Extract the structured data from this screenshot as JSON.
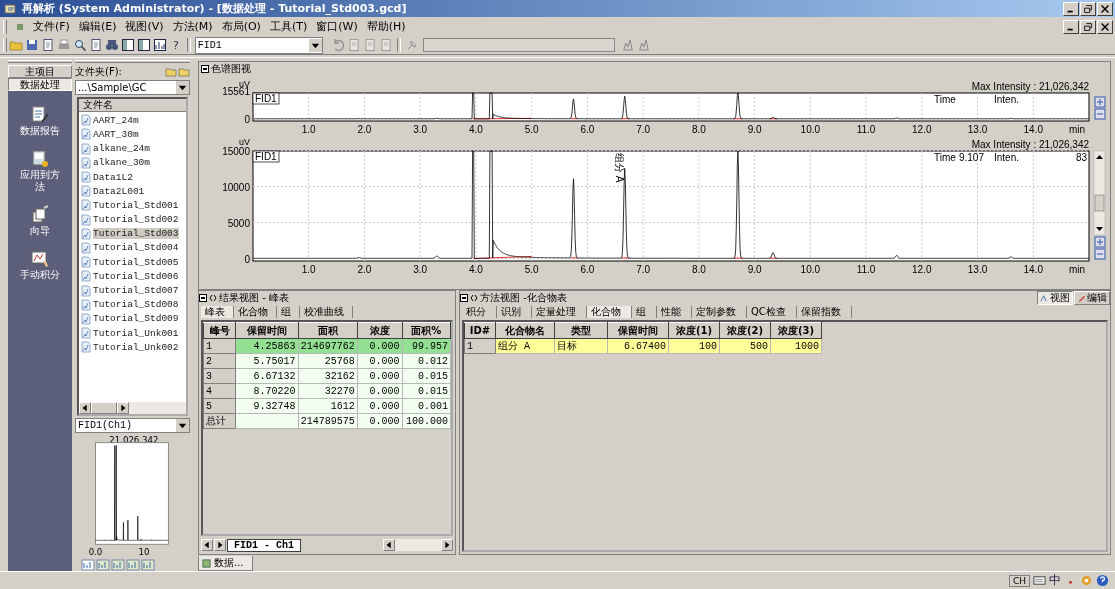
{
  "window": {
    "title": "再解析 (System Administrator) - [数据处理 - Tutorial_Std003.gcd]"
  },
  "menu": [
    "文件(F)",
    "编辑(E)",
    "视图(V)",
    "方法(M)",
    "布局(O)",
    "工具(T)",
    "窗口(W)",
    "帮助(H)"
  ],
  "toolbar": {
    "help": "?",
    "channel": "FID1"
  },
  "nav": {
    "tabs": [
      {
        "label": "主项目",
        "selected": false
      },
      {
        "label": "数据处理",
        "selected": true
      }
    ],
    "items": [
      "数据报告",
      "应用到方法",
      "向导",
      "手动积分"
    ]
  },
  "files": {
    "folder_label": "文件夹(F):",
    "folder": "...\\Sample\\GC",
    "column": "文件名",
    "items": [
      {
        "name": "AART_24m",
        "selected": false
      },
      {
        "name": "AART_30m",
        "selected": false
      },
      {
        "name": "alkane_24m",
        "selected": false
      },
      {
        "name": "alkane_30m",
        "selected": false
      },
      {
        "name": "Data1L2",
        "selected": false
      },
      {
        "name": "Data2L001",
        "selected": false
      },
      {
        "name": "Tutorial_Std001",
        "selected": false
      },
      {
        "name": "Tutorial_Std002",
        "selected": false
      },
      {
        "name": "Tutorial_Std003",
        "selected": true
      },
      {
        "name": "Tutorial_Std004",
        "selected": false
      },
      {
        "name": "Tutorial_Std005",
        "selected": false
      },
      {
        "name": "Tutorial_Std006",
        "selected": false
      },
      {
        "name": "Tutorial_Std007",
        "selected": false
      },
      {
        "name": "Tutorial_Std008",
        "selected": false
      },
      {
        "name": "Tutorial_Std009",
        "selected": false
      },
      {
        "name": "Tutorial_Unk001",
        "selected": false
      },
      {
        "name": "Tutorial_Unk002",
        "selected": false
      }
    ],
    "channel": "FID1(Ch1)",
    "preview_max": "21,026,342",
    "preview_xticks": [
      "0.0",
      "10"
    ]
  },
  "chromatogram_view": {
    "title": "色谱图视",
    "panels": [
      {
        "unit": "uV",
        "channel": "FID1",
        "max_intensity": "Max Intensity : 21,026,342",
        "time_label": "Time",
        "inten_label": "Inten.",
        "yticks": [
          "15561",
          "0"
        ],
        "xticks": [
          "1.0",
          "2.0",
          "3.0",
          "4.0",
          "5.0",
          "6.0",
          "7.0",
          "8.0",
          "9.0",
          "10.0",
          "11.0",
          "12.0",
          "13.0",
          "14.0"
        ],
        "xunit": "min"
      },
      {
        "unit": "uV",
        "channel": "FID1",
        "max_intensity": "Max Intensity : 21,026,342",
        "time_label": "Time",
        "time_value": "9.107",
        "inten_label": "Inten.",
        "inten_value": "83",
        "yticks": [
          "15000",
          "10000",
          "5000",
          "0"
        ],
        "xticks": [
          "1.0",
          "2.0",
          "3.0",
          "4.0",
          "5.0",
          "6.0",
          "7.0",
          "8.0",
          "9.0",
          "10.0",
          "11.0",
          "12.0",
          "13.0",
          "14.0"
        ],
        "xunit": "min",
        "peak_label": "组分 A"
      }
    ]
  },
  "results": {
    "title": "结果视图 -  峰表",
    "tabs": [
      {
        "label": "峰表",
        "selected": true
      },
      {
        "label": "化合物",
        "selected": false
      },
      {
        "label": "组",
        "selected": false
      },
      {
        "label": "校准曲线",
        "selected": false
      }
    ],
    "columns": [
      "峰号",
      "保留时间",
      "面积",
      "浓度",
      "面积%"
    ],
    "rows": [
      {
        "cells": [
          "1",
          "4.25863",
          "214697762",
          "0.000",
          "99.957"
        ],
        "selected": true
      },
      {
        "cells": [
          "2",
          "5.75017",
          "25768",
          "0.000",
          "0.012"
        ],
        "selected": false
      },
      {
        "cells": [
          "3",
          "6.67132",
          "32162",
          "0.000",
          "0.015"
        ],
        "selected": false
      },
      {
        "cells": [
          "4",
          "8.70220",
          "32270",
          "0.000",
          "0.015"
        ],
        "selected": false
      },
      {
        "cells": [
          "5",
          "9.32748",
          "1612",
          "0.000",
          "0.001"
        ],
        "selected": false
      }
    ],
    "total": {
      "label": "总计",
      "area": "214789575",
      "conc": "0.000",
      "percent": "100.000"
    },
    "sheet_tab": "FID1 - Ch1"
  },
  "method": {
    "title": "方法视图 -化合物表",
    "buttons": [
      "视图",
      "编辑"
    ],
    "tabs": [
      {
        "label": "积分",
        "selected": false
      },
      {
        "label": "识别",
        "selected": false
      },
      {
        "label": "定量处理",
        "selected": false
      },
      {
        "label": "化合物",
        "selected": true
      },
      {
        "label": "组",
        "selected": false
      },
      {
        "label": "性能",
        "selected": false
      },
      {
        "label": "定制参数",
        "selected": false
      },
      {
        "label": "QC检查",
        "selected": false
      },
      {
        "label": "保留指数",
        "selected": false
      }
    ],
    "columns": [
      "ID#",
      "化合物名",
      "类型",
      "保留时间",
      "浓度(1)",
      "浓度(2)",
      "浓度(3)"
    ],
    "rows": [
      [
        "1",
        "组分 A",
        "目标",
        "6.67400",
        "100",
        "500",
        "1000"
      ]
    ]
  },
  "doc_tab": "数据...",
  "status": {
    "ime": "CH",
    "input_mode": "中"
  }
}
